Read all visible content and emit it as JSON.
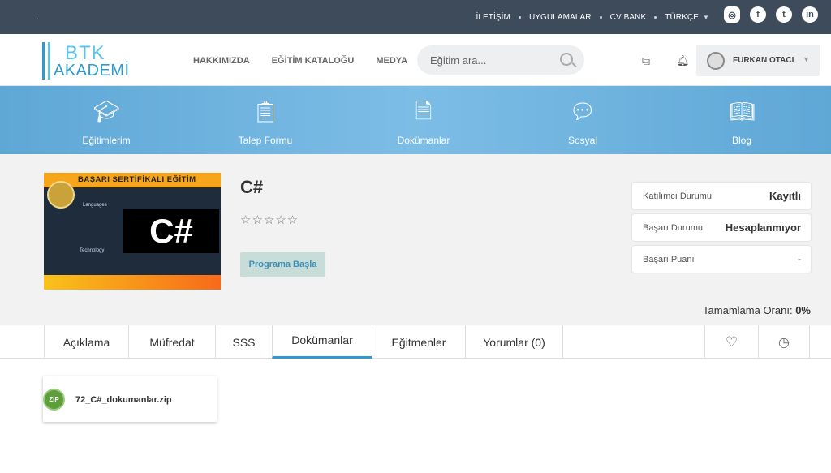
{
  "topbar": {
    "links": [
      "İLETİŞİM",
      "UYGULAMALAR",
      "CV BANK",
      "TÜRKÇE"
    ],
    "social": [
      "instagram-icon",
      "facebook-icon",
      "twitter-icon",
      "linkedin-icon"
    ]
  },
  "header": {
    "logo_line1": "BTK",
    "logo_line2": "AKADEMİ",
    "nav": [
      "HAKKIMIZDA",
      "EĞİTİM KATALOĞU",
      "MEDYA"
    ],
    "search_placeholder": "Eğitim ara...",
    "user_name": "FURKAN OTACI"
  },
  "banner": {
    "items": [
      {
        "label": "Eğitimlerim",
        "icon": "graduation-cap-icon"
      },
      {
        "label": "Talep Formu",
        "icon": "form-icon"
      },
      {
        "label": "Dokümanlar",
        "icon": "document-icon"
      },
      {
        "label": "Sosyal",
        "icon": "chat-icon"
      },
      {
        "label": "Blog",
        "icon": "book-icon"
      }
    ]
  },
  "course": {
    "thumb_banner": "BAŞARI SERTİFİKALI EĞİTİM",
    "thumb_text": "C#",
    "thumb_word1": "Languages",
    "thumb_word2": "Technology",
    "title": "C#",
    "rating": "☆☆☆☆☆",
    "start_button": "Programa Başla",
    "stats": [
      {
        "key": "Katılımcı Durumu",
        "value": "Kayıtlı"
      },
      {
        "key": "Başarı Durumu",
        "value": "Hesaplanmıyor"
      },
      {
        "key": "Başarı Puanı",
        "value": "-"
      }
    ],
    "completion_label": "Tamamlama Oranı:",
    "completion_value": "0%"
  },
  "tabs": [
    {
      "label": "Açıklama"
    },
    {
      "label": "Müfredat"
    },
    {
      "label": "SSS"
    },
    {
      "label": "Dokümanlar",
      "active": true
    },
    {
      "label": "Eğitmenler"
    },
    {
      "label": "Yorumlar (0)"
    }
  ],
  "files": [
    {
      "type": "ZIP",
      "name": "72_C#_dokumanlar.zip"
    }
  ]
}
